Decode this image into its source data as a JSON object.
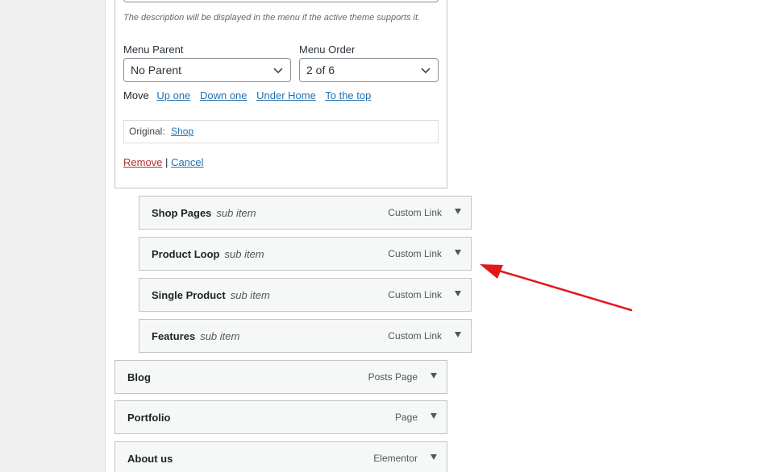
{
  "settings": {
    "description_note": "The description will be displayed in the menu if the active theme supports it.",
    "menu_parent_label": "Menu Parent",
    "menu_parent_value": "No Parent",
    "menu_order_label": "Menu Order",
    "menu_order_value": "2 of 6",
    "move_label": "Move",
    "move_links": [
      "Up one",
      "Down one",
      "Under Home",
      "To the top"
    ],
    "original_label": "Original:",
    "original_link": "Shop",
    "remove_label": "Remove",
    "separator": "|",
    "cancel_label": "Cancel"
  },
  "sub_items": [
    {
      "title": "Shop Pages",
      "sub_label": "sub item",
      "type": "Custom Link"
    },
    {
      "title": "Product Loop",
      "sub_label": "sub item",
      "type": "Custom Link"
    },
    {
      "title": "Single Product",
      "sub_label": "sub item",
      "type": "Custom Link"
    },
    {
      "title": "Features",
      "sub_label": "sub item",
      "type": "Custom Link"
    }
  ],
  "top_items": [
    {
      "title": "Blog",
      "type": "Posts Page"
    },
    {
      "title": "Portfolio",
      "type": "Page"
    },
    {
      "title": "About us",
      "type": "Elementor"
    }
  ],
  "colors": {
    "annotation_arrow": "#e3171b",
    "link": "#2271b1",
    "remove": "#b32d2e"
  },
  "icons": {
    "dropdown": "chevron-down-icon",
    "item_toggle": "triangle-down-icon",
    "annotation": "red-arrow-icon"
  }
}
